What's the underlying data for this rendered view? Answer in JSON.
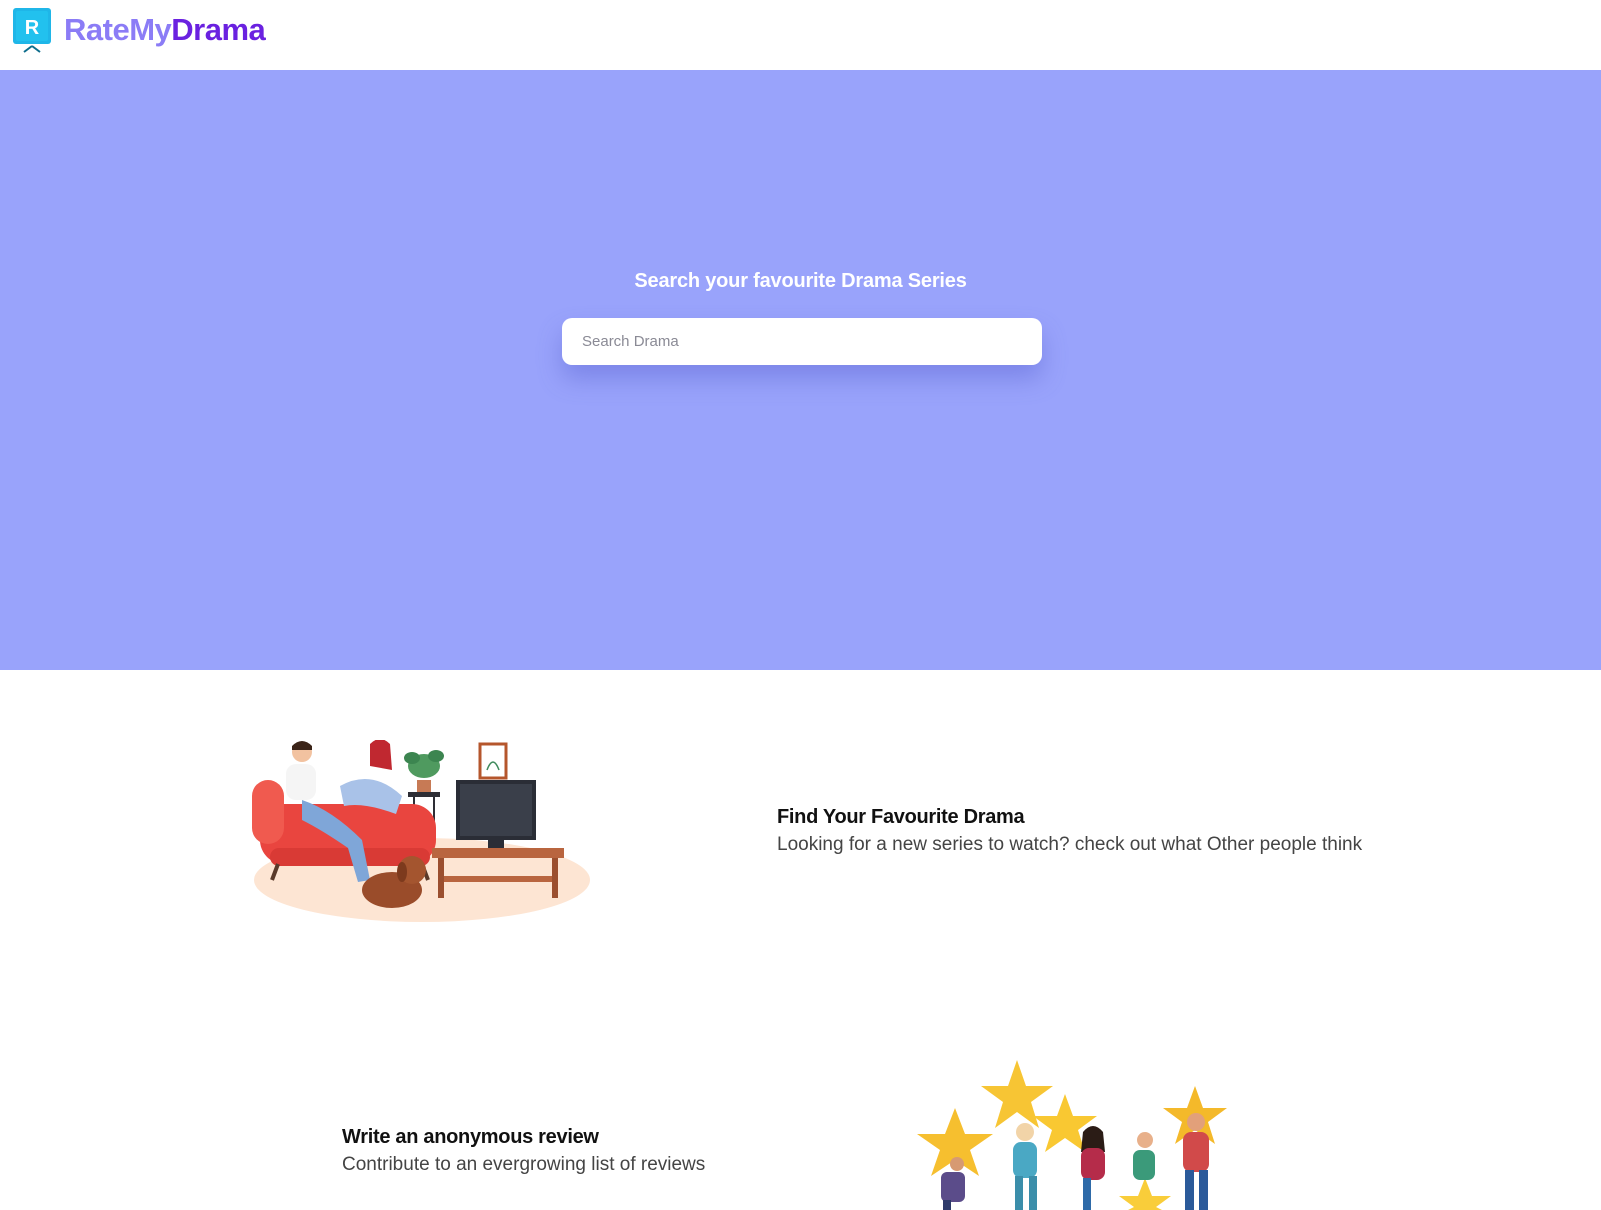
{
  "header": {
    "logo_letter": "R",
    "brand_part1": "RateMy",
    "brand_part2": "Drama"
  },
  "hero": {
    "title": "Search your favourite Drama Series",
    "search_placeholder": "Search Drama",
    "search_value": ""
  },
  "features": [
    {
      "title": "Find Your Favourite Drama",
      "description": "Looking for a new series to watch? check out what Other people think",
      "image_icon": "couch-tv-illustration"
    },
    {
      "title": "Write an anonymous review",
      "description": "Contribute to an evergrowing list of reviews",
      "image_icon": "people-holding-stars-illustration"
    }
  ],
  "colors": {
    "hero_bg": "#99a3fb",
    "brand_light": "#8b7cf6",
    "brand_dark": "#6a21e0",
    "logo_tile": "#1fb6e8"
  }
}
